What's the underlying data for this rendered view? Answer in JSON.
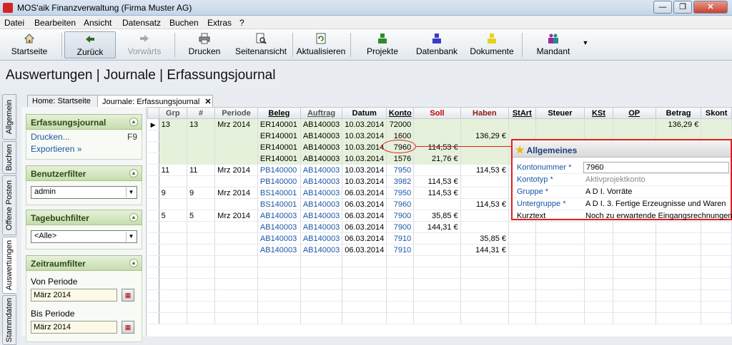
{
  "window": {
    "title": "MOS'aik Finanzverwaltung (Firma Muster AG)"
  },
  "menu": [
    "Datei",
    "Bearbeiten",
    "Ansicht",
    "Datensatz",
    "Buchen",
    "Extras",
    "?"
  ],
  "toolbar": {
    "startseite": "Startseite",
    "zurueck": "Zurück",
    "vorwaerts": "Vorwärts",
    "drucken": "Drucken",
    "seitenansicht": "Seitenansicht",
    "aktualisieren": "Aktualisieren",
    "projekte": "Projekte",
    "datenbank": "Datenbank",
    "dokumente": "Dokumente",
    "mandant": "Mandant"
  },
  "page_title": "Auswertungen | Journale | Erfassungsjournal",
  "vertical_tabs": [
    "Allgemein",
    "Buchen",
    "Offene Posten",
    "Auswertungen",
    "Stammdaten"
  ],
  "doc_tabs": {
    "home": "Home: Startseite",
    "journal": "Journale: Erfassungsjournal"
  },
  "sidebar": {
    "erfassungsjournal": {
      "title": "Erfassungsjournal",
      "drucken": "Drucken...",
      "drucken_key": "F9",
      "exportieren": "Exportieren »"
    },
    "benutzerfilter": {
      "title": "Benutzerfilter",
      "value": "admin"
    },
    "tagebuchfilter": {
      "title": "Tagebuchfilter",
      "value": "<Alle>"
    },
    "zeitraumfilter": {
      "title": "Zeitraumfilter",
      "von_label": "Von Periode",
      "von_value": "März 2014",
      "bis_label": "Bis Periode",
      "bis_value": "März 2014"
    }
  },
  "grid": {
    "columns": [
      "Grp",
      "#",
      "Periode",
      "Beleg",
      "Auftrag",
      "Datum",
      "Konto",
      "Soll",
      "Haben",
      "StArt",
      "Steuer",
      "KSt",
      "OP",
      "Betrag",
      "Skont"
    ],
    "rows": [
      {
        "grp": "13",
        "nr": "13",
        "periode": "Mrz 2014",
        "beleg": "ER140001",
        "auftrag": "AB140003",
        "datum": "10.03.2014",
        "konto": "72000",
        "soll": "",
        "haben": "",
        "betrag": "136,29 €",
        "green": true
      },
      {
        "grp": "",
        "nr": "",
        "periode": "",
        "beleg": "ER140001",
        "auftrag": "AB140003",
        "datum": "10.03.2014",
        "konto": "1600",
        "soll": "",
        "haben": "136,29 €",
        "betrag": "",
        "green": true
      },
      {
        "grp": "",
        "nr": "",
        "periode": "",
        "beleg": "ER140001",
        "auftrag": "AB140003",
        "datum": "10.03.2014",
        "konto": "7960",
        "soll": "114,53 €",
        "haben": "",
        "betrag": "",
        "green": true
      },
      {
        "grp": "",
        "nr": "",
        "periode": "",
        "beleg": "ER140001",
        "auftrag": "AB140003",
        "datum": "10.03.2014",
        "konto": "1576",
        "soll": "21,76 €",
        "haben": "",
        "betrag": "",
        "green": true
      },
      {
        "grp": "11",
        "nr": "11",
        "periode": "Mrz 2014",
        "beleg": "PB140000",
        "auftrag": "AB140003",
        "datum": "10.03.2014",
        "konto": "7950",
        "soll": "",
        "haben": "114,53 €",
        "betrag": "",
        "green": false
      },
      {
        "grp": "",
        "nr": "",
        "periode": "",
        "beleg": "PB140000",
        "auftrag": "AB140003",
        "datum": "10.03.2014",
        "konto": "3982",
        "soll": "114,53 €",
        "haben": "",
        "betrag": "",
        "green": false
      },
      {
        "grp": "9",
        "nr": "9",
        "periode": "Mrz 2014",
        "beleg": "BS140001",
        "auftrag": "AB140003",
        "datum": "06.03.2014",
        "konto": "7950",
        "soll": "114,53 €",
        "haben": "",
        "betrag": "",
        "green": false
      },
      {
        "grp": "",
        "nr": "",
        "periode": "",
        "beleg": "BS140001",
        "auftrag": "AB140003",
        "datum": "06.03.2014",
        "konto": "7960",
        "soll": "",
        "haben": "114,53 €",
        "betrag": "",
        "green": false
      },
      {
        "grp": "5",
        "nr": "5",
        "periode": "Mrz 2014",
        "beleg": "AB140003",
        "auftrag": "AB140003",
        "datum": "06.03.2014",
        "konto": "7900",
        "soll": "35,85 €",
        "haben": "",
        "betrag": "",
        "green": false
      },
      {
        "grp": "",
        "nr": "",
        "periode": "",
        "beleg": "AB140003",
        "auftrag": "AB140003",
        "datum": "06.03.2014",
        "konto": "7900",
        "soll": "144,31 €",
        "haben": "",
        "betrag": "",
        "green": false
      },
      {
        "grp": "",
        "nr": "",
        "periode": "",
        "beleg": "AB140003",
        "auftrag": "AB140003",
        "datum": "06.03.2014",
        "konto": "7910",
        "soll": "",
        "haben": "35,85 €",
        "betrag": "",
        "green": false
      },
      {
        "grp": "",
        "nr": "",
        "periode": "",
        "beleg": "AB140003",
        "auftrag": "AB140003",
        "datum": "06.03.2014",
        "konto": "7910",
        "soll": "",
        "haben": "144,31 €",
        "betrag": "",
        "green": false
      }
    ],
    "blue_beleg_from_row": 4
  },
  "popup": {
    "title": "Allgemeines",
    "rows": [
      {
        "key": "Kontonummer *",
        "value": "7960"
      },
      {
        "key": "Kontotyp *",
        "value": "Aktivprojektkonto"
      },
      {
        "key": "Gruppe *",
        "value": "A D I. Vorräte"
      },
      {
        "key": "Untergruppe *",
        "value": "A D I. 3. Fertige Erzeugnisse und Waren"
      },
      {
        "key": "Kurztext",
        "value": "Noch zu erwartende Eingangsrechnungen"
      }
    ]
  },
  "colors": {
    "accent_green": "#2c4a16",
    "link_blue": "#1a56a8",
    "highlight_red": "#e11e1e",
    "soll_red": "#c00000",
    "haben_red": "#8b1a1a"
  }
}
